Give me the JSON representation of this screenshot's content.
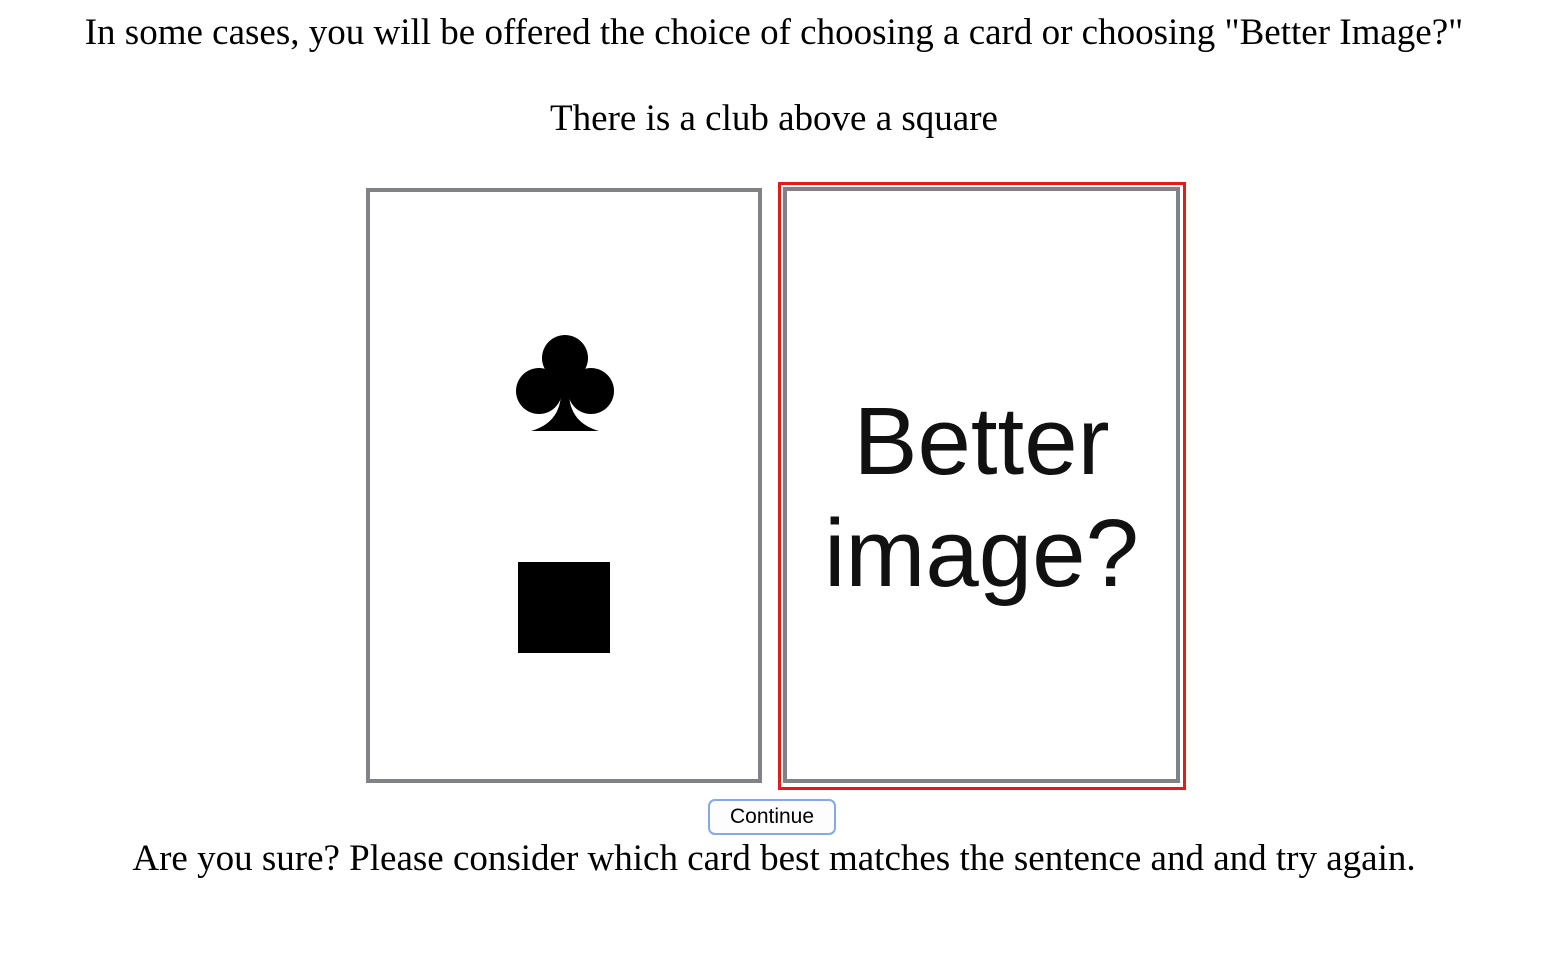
{
  "instruction": "In some cases, you will be offered the choice of choosing a card or choosing \"Better Image?\"",
  "sentence": "There is a club above a square",
  "cards": {
    "left": {
      "top_symbol": "club",
      "bottom_symbol": "square"
    },
    "right": {
      "label_line1": "Better",
      "label_line2": "image?",
      "selected": true
    }
  },
  "colors": {
    "card_border": "#808285",
    "selection_border": "#e41b1b",
    "button_border": "#84a9e6"
  },
  "continue_button": {
    "label": "Continue"
  },
  "feedback": "Are you sure? Please consider which card best matches the sentence and and try again."
}
